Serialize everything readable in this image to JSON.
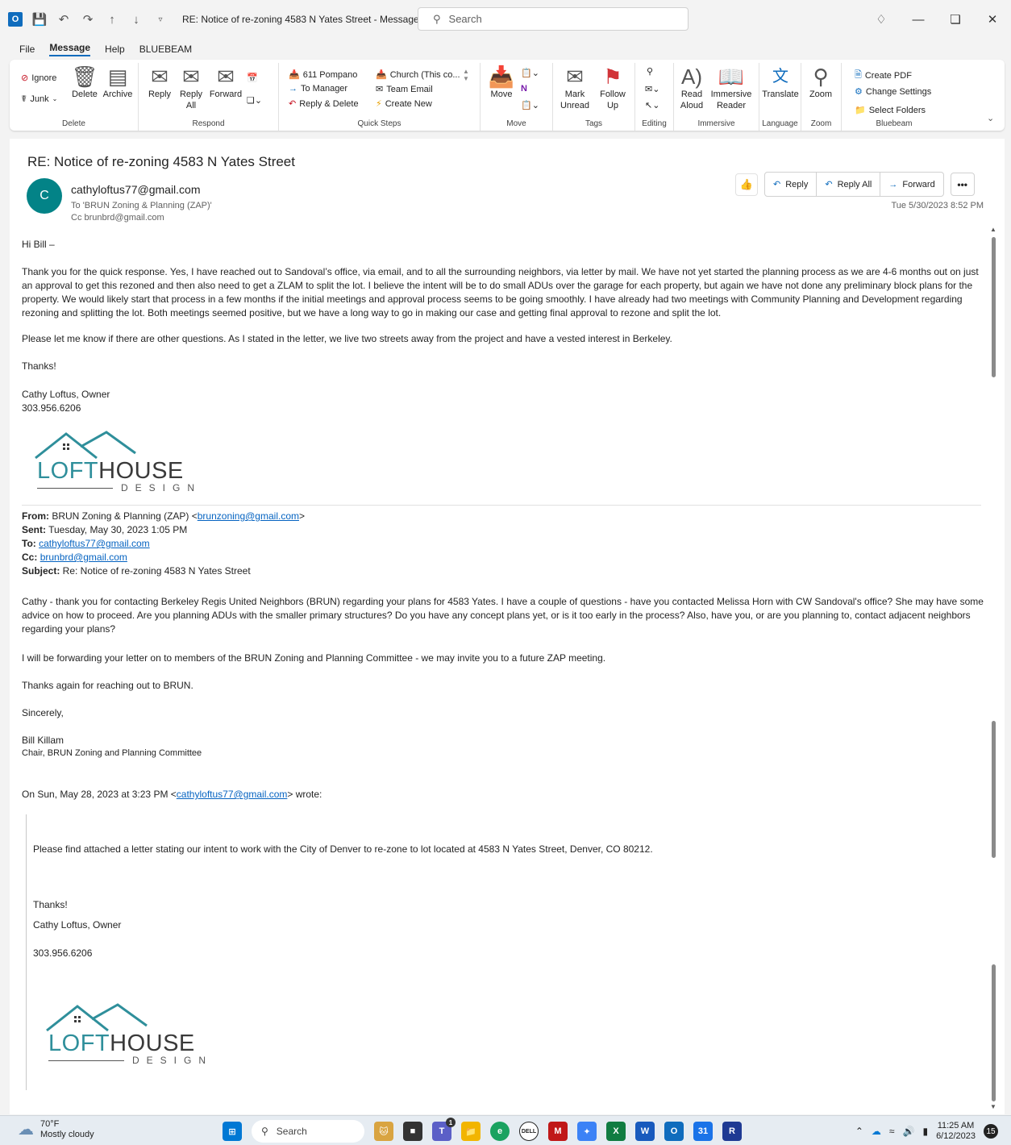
{
  "window": {
    "title": "RE: Notice of re-zoning 4583 N Yates Street  -  Message (H...",
    "search_placeholder": "Search"
  },
  "menu": [
    "File",
    "Message",
    "Help",
    "BLUEBEAM"
  ],
  "ribbon": {
    "delete": {
      "ignore": "Ignore",
      "junk": "Junk",
      "delete": "Delete",
      "archive": "Archive",
      "label": "Delete"
    },
    "respond": {
      "reply": "Reply",
      "reply_all": "Reply All",
      "forward": "Forward",
      "label": "Respond"
    },
    "quick_steps": {
      "items": [
        "611 Pompano",
        "To Manager",
        "Reply & Delete",
        "Church (This co...",
        "Team Email",
        "Create New"
      ],
      "label": "Quick Steps"
    },
    "move": {
      "move": "Move",
      "label": "Move"
    },
    "tags": {
      "mark_unread": "Mark Unread",
      "follow_up": "Follow Up",
      "label": "Tags"
    },
    "editing": {
      "label": "Editing"
    },
    "immersive": {
      "read_aloud": "Read Aloud",
      "immersive_reader": "Immersive Reader",
      "label": "Immersive"
    },
    "language": {
      "translate": "Translate",
      "label": "Language"
    },
    "zoom": {
      "zoom": "Zoom",
      "label": "Zoom"
    },
    "bluebeam": {
      "create_pdf": "Create PDF",
      "change_settings": "Change Settings",
      "select_folders": "Select Folders",
      "label": "Bluebeam"
    }
  },
  "message": {
    "subject": "RE: Notice of re-zoning 4583 N Yates Street",
    "avatar_initial": "C",
    "sender": "cathyloftus77@gmail.com",
    "to": "To  'BRUN Zoning & Planning (ZAP)'",
    "cc": "Cc  brunbrd@gmail.com",
    "date": "Tue 5/30/2023 8:52 PM",
    "actions": {
      "reply": "Reply",
      "reply_all": "Reply All",
      "forward": "Forward",
      "more": "•••"
    },
    "greeting": "Hi Bill –",
    "p1": "Thank you for the quick response.  Yes, I have reached out to Sandoval’s office, via email, and to all the surrounding neighbors, via letter by mail.  We have not yet started the planning process as we are 4-6 months out on just an approval to get this rezoned and then also need to get a ZLAM to split the lot.  I believe the intent will be to do small ADUs over the garage for each property, but again we have not done any preliminary block plans for the property.  We would likely start that process in a few months if the initial meetings and approval process seems to be going smoothly.  I have already had two meetings with Community Planning and Development regarding rezoning and splitting the lot.  Both meetings seemed positive, but we have a long way to go in making our case and getting final approval to rezone and split the lot.",
    "p2": "Please let me know if there are other questions.  As I stated in the letter, we live two streets away from the project and have a vested interest in Berkeley.",
    "thanks": "Thanks!",
    "sig_name": "Cathy Loftus, Owner",
    "sig_phone": "303.956.6206",
    "logo": {
      "l": "L",
      "oft": "OFT",
      "house": "HOUSE",
      "design": "DESIGN"
    },
    "quoted_header": {
      "from_label": "From:",
      "from": " BRUN Zoning & Planning (ZAP) <",
      "from_email": "brunzoning@gmail.com",
      "from_end": ">",
      "sent_label": "Sent:",
      "sent": " Tuesday, May 30, 2023 1:05 PM",
      "to_label": "To:",
      "to_email": "cathyloftus77@gmail.com",
      "cc_label": "Cc:",
      "cc_email": "brunbrd@gmail.com",
      "subject_label": "Subject:",
      "subject": " Re: Notice of re-zoning 4583 N Yates Street"
    },
    "reply_p1": "Cathy - thank you for contacting Berkeley Regis United Neighbors (BRUN) regarding your plans for 4583 Yates. I have a couple of questions - have you contacted Melissa Horn with CW Sandoval's office? She may have some advice on how to proceed.  Are you planning ADUs with the smaller primary structures? Do you have any concept plans yet, or is it too early in the process? Also, have you, or are you planning to, contact adjacent neighbors regarding your plans?",
    "reply_p2": "I will be forwarding your letter on to members of the BRUN Zoning and Planning Committee - we may invite you to a future ZAP meeting.",
    "reply_p3": "Thanks again for reaching out to BRUN.",
    "reply_p4": "Sincerely,",
    "reply_sig1": "Bill Killam",
    "reply_sig2": "Chair, BRUN Zoning and Planning Committee",
    "orig_intro": "On Sun, May 28, 2023 at 3:23 PM <",
    "orig_email": "cathyloftus77@gmail.com",
    "orig_intro_end": "> wrote:",
    "orig_p1": "Please find attached a letter stating our intent to work with the City of Denver to re-zone to lot located at 4583 N Yates Street, Denver, CO 80212.",
    "orig_thanks": "Thanks!",
    "orig_sig_name": "Cathy Loftus, Owner",
    "orig_sig_phone": "303.956.6206"
  },
  "taskbar": {
    "temp": "70°F",
    "weather": "Mostly cloudy",
    "search": "Search",
    "time": "11:25 AM",
    "date": "6/12/2023",
    "notifications": "15",
    "teams_badge": "1"
  }
}
